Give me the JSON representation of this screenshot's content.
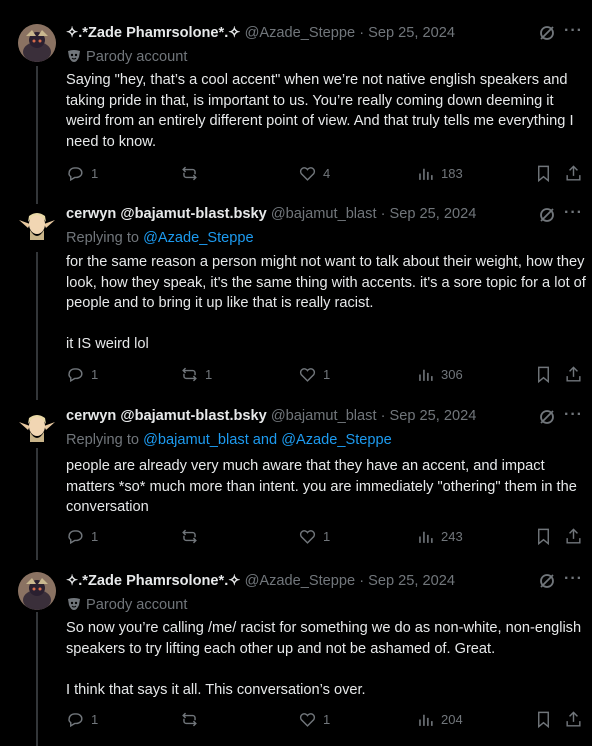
{
  "tweets": [
    {
      "display_name": "✧.*Zade Phamrsolone*.✧",
      "handle": "@Azade_Steppe",
      "date": "Sep 25, 2024",
      "sub_label": "Parody account",
      "body": [
        "Saying \"hey, that’s a cool accent\" when we’re not native english speakers and taking pride in that, is important to us. You’re really coming down deeming it weird from an entirely different point of view. And that truly tells me everything I need to know."
      ],
      "replies": "1",
      "reposts": "",
      "likes": "4",
      "views": "183"
    },
    {
      "display_name": "cerwyn @bajamut-blast.bsky",
      "handle": "@bajamut_blast",
      "date": "Sep 25, 2024",
      "replying_prefix": "Replying to ",
      "replying_to": "@Azade_Steppe",
      "body": [
        "for the same reason a person might not want to talk about their weight, how they look, how they speak, it's the same thing with accents. it's a sore topic for a lot of people and to bring it up like that is really racist.",
        "it IS weird lol"
      ],
      "replies": "1",
      "reposts": "1",
      "likes": "1",
      "views": "306"
    },
    {
      "display_name": "cerwyn @bajamut-blast.bsky",
      "handle": "@bajamut_blast",
      "date": "Sep 25, 2024",
      "replying_prefix": "Replying to ",
      "replying_to": "@bajamut_blast and @Azade_Steppe",
      "body": [
        "people are already very much aware that they have an accent, and impact matters *so* much more than intent.   you are immediately \"othering\" them in the conversation"
      ],
      "replies": "1",
      "reposts": "",
      "likes": "1",
      "views": "243"
    },
    {
      "display_name": "✧.*Zade Phamrsolone*.✧",
      "handle": "@Azade_Steppe",
      "date": "Sep 25, 2024",
      "sub_label": "Parody account",
      "body": [
        "So now you’re calling /me/ racist for something we do as non-white, non-english speakers to try lifting each other up and not be ashamed of. Great.",
        "I think that says it all. This conversation’s over."
      ],
      "replies": "1",
      "reposts": "",
      "likes": "1",
      "views": "204"
    }
  ],
  "separator": " · ",
  "more_glyph": "···",
  "colors": {
    "background": "#000000",
    "text": "#e7e9ea",
    "muted": "#71767b",
    "link": "#1d9bf0",
    "rail": "#333639"
  }
}
